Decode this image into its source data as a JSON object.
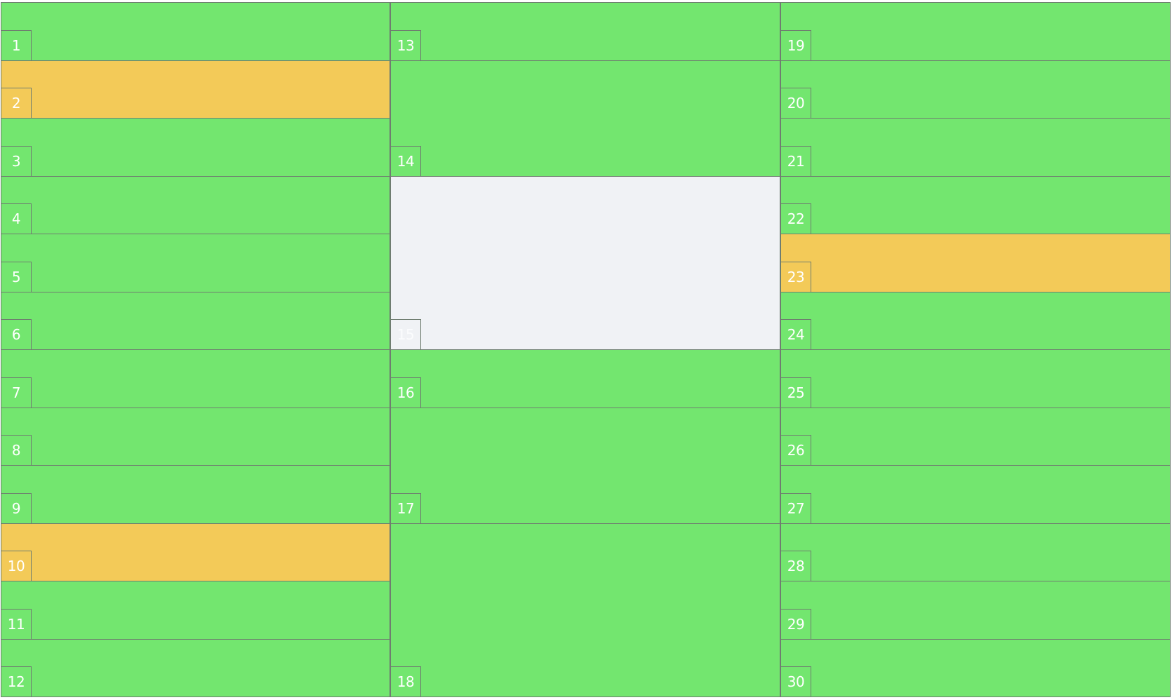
{
  "columns": [
    {
      "spots": [
        {
          "number": "1",
          "status": "available",
          "span": 1
        },
        {
          "number": "2",
          "status": "reserved",
          "span": 1
        },
        {
          "number": "3",
          "status": "available",
          "span": 1
        },
        {
          "number": "4",
          "status": "available",
          "span": 1
        },
        {
          "number": "5",
          "status": "available",
          "span": 1
        },
        {
          "number": "6",
          "status": "available",
          "span": 1
        },
        {
          "number": "7",
          "status": "available",
          "span": 1
        },
        {
          "number": "8",
          "status": "available",
          "span": 1
        },
        {
          "number": "9",
          "status": "available",
          "span": 1
        },
        {
          "number": "10",
          "status": "reserved",
          "span": 1
        },
        {
          "number": "11",
          "status": "available",
          "span": 1
        },
        {
          "number": "12",
          "status": "available",
          "span": 1
        }
      ]
    },
    {
      "spots": [
        {
          "number": "13",
          "status": "available",
          "span": 1
        },
        {
          "number": "14",
          "status": "available",
          "span": 2
        },
        {
          "number": "15",
          "status": "empty",
          "span": 3
        },
        {
          "number": "16",
          "status": "available",
          "span": 1
        },
        {
          "number": "17",
          "status": "available",
          "span": 2
        },
        {
          "number": "18",
          "status": "available",
          "span": 3
        }
      ]
    },
    {
      "spots": [
        {
          "number": "19",
          "status": "available",
          "span": 1
        },
        {
          "number": "20",
          "status": "available",
          "span": 1
        },
        {
          "number": "21",
          "status": "available",
          "span": 1
        },
        {
          "number": "22",
          "status": "available",
          "span": 1
        },
        {
          "number": "23",
          "status": "reserved",
          "span": 1
        },
        {
          "number": "24",
          "status": "available",
          "span": 1
        },
        {
          "number": "25",
          "status": "available",
          "span": 1
        },
        {
          "number": "26",
          "status": "available",
          "span": 1
        },
        {
          "number": "27",
          "status": "available",
          "span": 1
        },
        {
          "number": "28",
          "status": "available",
          "span": 1
        },
        {
          "number": "29",
          "status": "available",
          "span": 1
        },
        {
          "number": "30",
          "status": "available",
          "span": 1
        }
      ]
    }
  ],
  "colors": {
    "available": "#73e66f",
    "reserved": "#f3ca58",
    "empty": "#f0f2f5",
    "border": "#6f7d70",
    "label": "#ffffff"
  }
}
